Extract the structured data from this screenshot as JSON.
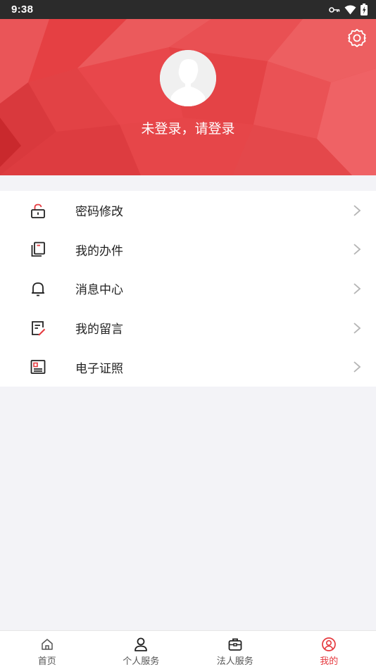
{
  "status_bar": {
    "time": "9:38"
  },
  "header": {
    "login_prompt": "未登录，请登录",
    "accent_color": "#e8474b"
  },
  "menu": {
    "items": [
      {
        "label": "密码修改",
        "icon": "lock-icon"
      },
      {
        "label": "我的办件",
        "icon": "documents-icon"
      },
      {
        "label": "消息中心",
        "icon": "bell-icon"
      },
      {
        "label": "我的留言",
        "icon": "note-edit-icon"
      },
      {
        "label": "电子证照",
        "icon": "id-card-icon"
      }
    ]
  },
  "tabbar": {
    "tabs": [
      {
        "label": "首页",
        "icon": "home-icon",
        "active": false
      },
      {
        "label": "个人服务",
        "icon": "person-icon",
        "active": false
      },
      {
        "label": "法人服务",
        "icon": "briefcase-icon",
        "active": false
      },
      {
        "label": "我的",
        "icon": "user-circle-icon",
        "active": true
      }
    ],
    "active_color": "#e53a3f"
  }
}
